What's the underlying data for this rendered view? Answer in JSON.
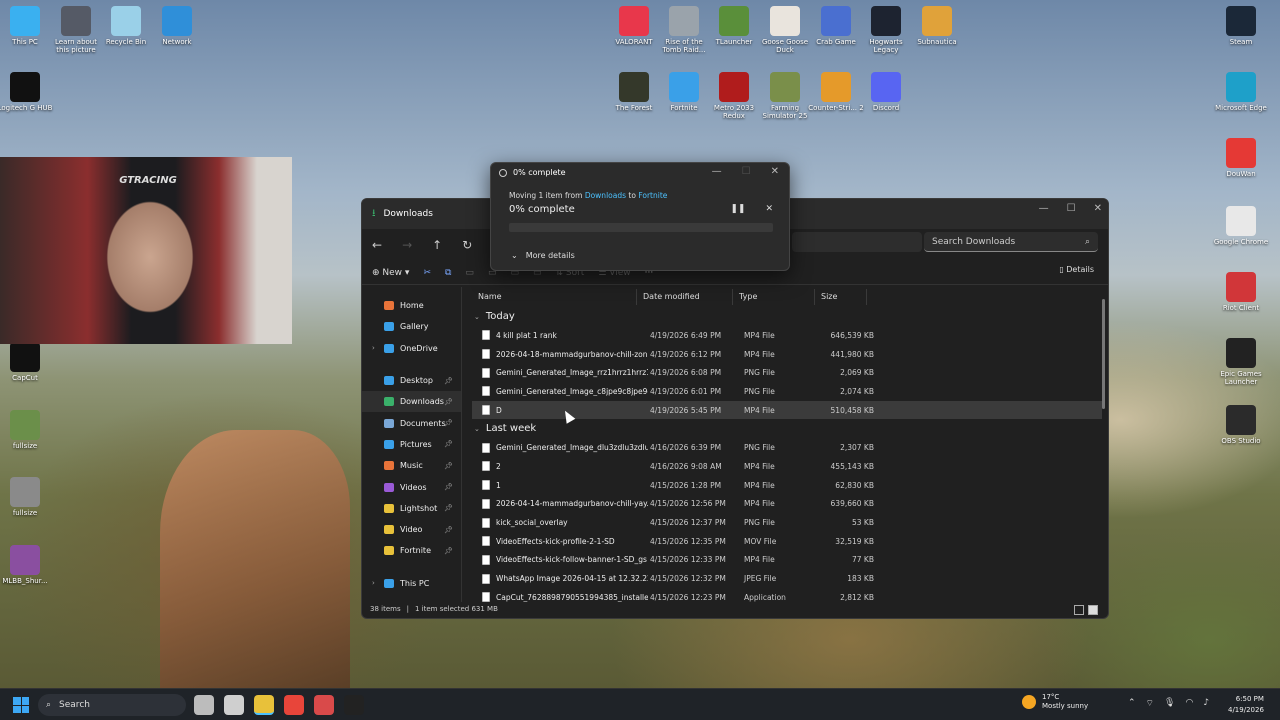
{
  "desktop": {
    "left_icons": [
      {
        "label": "This PC",
        "icon": "this-pc-icon",
        "color": "#3ab0f0"
      },
      {
        "label": "Learn about this picture",
        "icon": "learn-icon",
        "color": "#555a66"
      },
      {
        "label": "Recycle Bin",
        "icon": "recycle-bin-icon",
        "color": "#9ad0e8"
      },
      {
        "label": "Network",
        "icon": "network-icon",
        "color": "#2f8fd9"
      },
      {
        "label": "Logitech G HUB",
        "icon": "logitech-icon",
        "color": "#111111"
      },
      {
        "label": "CapCut",
        "icon": "capcut-icon",
        "color": "#111111"
      },
      {
        "label": "fullsize",
        "icon": "image-file-icon",
        "color": "#6b8f4a"
      },
      {
        "label": "fullsize",
        "icon": "image-file-icon",
        "color": "#8a8a8a"
      },
      {
        "label": "MLBB_Shur...",
        "icon": "image-file-icon",
        "color": "#8a4fa0"
      }
    ],
    "top_icons": [
      {
        "label": "VALORANT",
        "icon": "valorant-icon",
        "color": "#e8374b"
      },
      {
        "label": "Rise of the Tomb Raid...",
        "icon": "tomb-raider-icon",
        "color": "#9aa3ab"
      },
      {
        "label": "TLauncher",
        "icon": "tlauncher-icon",
        "color": "#5a8f3a"
      },
      {
        "label": "Goose Goose Duck",
        "icon": "goose-icon",
        "color": "#e9e4dd"
      },
      {
        "label": "Crab Game",
        "icon": "crab-game-icon",
        "color": "#4a6fd0"
      },
      {
        "label": "Hogwarts Legacy",
        "icon": "hogwarts-icon",
        "color": "#1d2330"
      },
      {
        "label": "Subnautica",
        "icon": "subnautica-icon",
        "color": "#e0a23a"
      },
      {
        "label": "The Forest",
        "icon": "forest-icon",
        "color": "#34382a"
      },
      {
        "label": "Fortnite",
        "icon": "fortnite-icon",
        "color": "#3aa0e8"
      },
      {
        "label": "Metro 2033 Redux",
        "icon": "metro-icon",
        "color": "#b01c1c"
      },
      {
        "label": "Farming Simulator 25",
        "icon": "farming-icon",
        "color": "#7a8f4a"
      },
      {
        "label": "Counter-Stri... 2",
        "icon": "counter-strike-icon",
        "color": "#e59a2a"
      },
      {
        "label": "Discord",
        "icon": "discord-icon",
        "color": "#5865f2"
      }
    ],
    "right_icons": [
      {
        "label": "Steam",
        "icon": "steam-icon",
        "color": "#1b2838"
      },
      {
        "label": "Microsoft Edge",
        "icon": "edge-icon",
        "color": "#1ea0c9"
      },
      {
        "label": "DouWan",
        "icon": "douwan-icon",
        "color": "#e53935"
      },
      {
        "label": "Google Chrome",
        "icon": "chrome-icon",
        "color": "#e8e8e8"
      },
      {
        "label": "Riot Client",
        "icon": "riot-icon",
        "color": "#d13639"
      },
      {
        "label": "Epic Games Launcher",
        "icon": "epic-icon",
        "color": "#222222"
      },
      {
        "label": "OBS Studio",
        "icon": "obs-icon",
        "color": "#2b2b2b"
      }
    ],
    "webcam_chair_text": "GTRACING"
  },
  "explorer": {
    "tab_title": "Downloads",
    "search_placeholder": "Search Downloads",
    "toolbar": {
      "new": "New",
      "sort": "Sort",
      "view": "View",
      "more": "···",
      "details": "Details"
    },
    "sidebar": [
      {
        "label": "Home",
        "icon": "home-icon",
        "color": "#e8743a",
        "pinned": false
      },
      {
        "label": "Gallery",
        "icon": "gallery-icon",
        "color": "#3aa0e8",
        "pinned": false
      },
      {
        "label": "OneDrive",
        "icon": "onedrive-icon",
        "color": "#3aa0e8",
        "pinned": false,
        "expandable": true
      },
      {
        "label": "Desktop",
        "icon": "desktop-icon",
        "color": "#3aa0e8",
        "pinned": true
      },
      {
        "label": "Downloads",
        "icon": "downloads-icon",
        "color": "#3ab06a",
        "pinned": true,
        "active": true
      },
      {
        "label": "Documents",
        "icon": "documents-icon",
        "color": "#7aa7d6",
        "pinned": true
      },
      {
        "label": "Pictures",
        "icon": "pictures-icon",
        "color": "#3aa0e8",
        "pinned": true
      },
      {
        "label": "Music",
        "icon": "music-icon",
        "color": "#e8743a",
        "pinned": true
      },
      {
        "label": "Videos",
        "icon": "videos-icon",
        "color": "#9a5ad6",
        "pinned": true
      },
      {
        "label": "Lightshot",
        "icon": "folder-icon",
        "color": "#e8c13a",
        "pinned": true
      },
      {
        "label": "Video",
        "icon": "folder-icon",
        "color": "#e8c13a",
        "pinned": true
      },
      {
        "label": "Fortnite",
        "icon": "folder-icon",
        "color": "#e8c13a",
        "pinned": true
      },
      {
        "label": "This PC",
        "icon": "this-pc-icon",
        "color": "#3aa0e8",
        "pinned": false,
        "expandable": true
      }
    ],
    "columns": {
      "name": "Name",
      "date": "Date modified",
      "type": "Type",
      "size": "Size"
    },
    "groups": [
      {
        "label": "Today",
        "files": [
          {
            "name": "4 kill plat 1 rank",
            "date": "4/19/2026 6:49 PM",
            "type": "MP4 File",
            "size": "646,539 KB"
          },
          {
            "name": "2026-04-18-mammadgurbanov-chill-zon...",
            "date": "4/19/2026 6:12 PM",
            "type": "MP4 File",
            "size": "441,980 KB"
          },
          {
            "name": "Gemini_Generated_Image_rrz1hrrz1hrrz1hr",
            "date": "4/19/2026 6:08 PM",
            "type": "PNG File",
            "size": "2,069 KB"
          },
          {
            "name": "Gemini_Generated_Image_c8jpe9c8jpe9c...",
            "date": "4/19/2026 6:01 PM",
            "type": "PNG File",
            "size": "2,074 KB"
          },
          {
            "name": "D",
            "date": "4/19/2026 5:45 PM",
            "type": "MP4 File",
            "size": "510,458 KB",
            "selected": true
          }
        ]
      },
      {
        "label": "Last week",
        "files": [
          {
            "name": "Gemini_Generated_Image_dlu3zdlu3zdlu...",
            "date": "4/16/2026 6:39 PM",
            "type": "PNG File",
            "size": "2,307 KB"
          },
          {
            "name": "2",
            "date": "4/16/2026 9:08 AM",
            "type": "MP4 File",
            "size": "455,143 KB"
          },
          {
            "name": "1",
            "date": "4/15/2026 1:28 PM",
            "type": "MP4 File",
            "size": "62,830 KB"
          },
          {
            "name": "2026-04-14-mammadgurbanov-chill-yay...",
            "date": "4/15/2026 12:56 PM",
            "type": "MP4 File",
            "size": "639,660 KB"
          },
          {
            "name": "kick_social_overlay",
            "date": "4/15/2026 12:37 PM",
            "type": "PNG File",
            "size": "53 KB"
          },
          {
            "name": "VideoEffects-kick-profile-2-1-SD",
            "date": "4/15/2026 12:35 PM",
            "type": "MOV File",
            "size": "32,519 KB"
          },
          {
            "name": "VideoEffects-kick-follow-banner-1-SD_gs",
            "date": "4/15/2026 12:33 PM",
            "type": "MP4 File",
            "size": "77 KB"
          },
          {
            "name": "WhatsApp Image 2026-04-15 at 12.32.22",
            "date": "4/15/2026 12:32 PM",
            "type": "JPEG File",
            "size": "183 KB"
          },
          {
            "name": "CapCut_7628898790551994385_installer",
            "date": "4/15/2026 12:23 PM",
            "type": "Application",
            "size": "2,812 KB"
          }
        ]
      }
    ],
    "status": {
      "items": "38 items",
      "selected": "1 item selected  631 MB"
    }
  },
  "progress_dialog": {
    "title": "0% complete",
    "line_prefix": "Moving 1 item from ",
    "source": "Downloads",
    "line_mid": " to ",
    "dest": "Fortnite",
    "percent_text": "0% complete",
    "progress": 0,
    "more_details": "More details"
  },
  "taskbar": {
    "search_label": "Search",
    "apps": [
      {
        "name": "widgets",
        "icon": "widgets-icon",
        "color": "#bcbcbc"
      },
      {
        "name": "task-view",
        "icon": "task-view-icon",
        "color": "#cfcfcf"
      },
      {
        "name": "file-explorer",
        "icon": "file-explorer-icon",
        "color": "#e8c13a",
        "active": true
      },
      {
        "name": "chrome",
        "icon": "chrome-icon",
        "color": "#e8453a"
      },
      {
        "name": "app",
        "icon": "app-icon",
        "color": "#d94a4a"
      },
      {
        "name": "capcut",
        "icon": "capcut-icon",
        "color": "#222222"
      }
    ],
    "weather_temp": "17°C",
    "weather_desc": "Mostly sunny",
    "time": "6:50 PM",
    "date": "4/19/2026"
  }
}
